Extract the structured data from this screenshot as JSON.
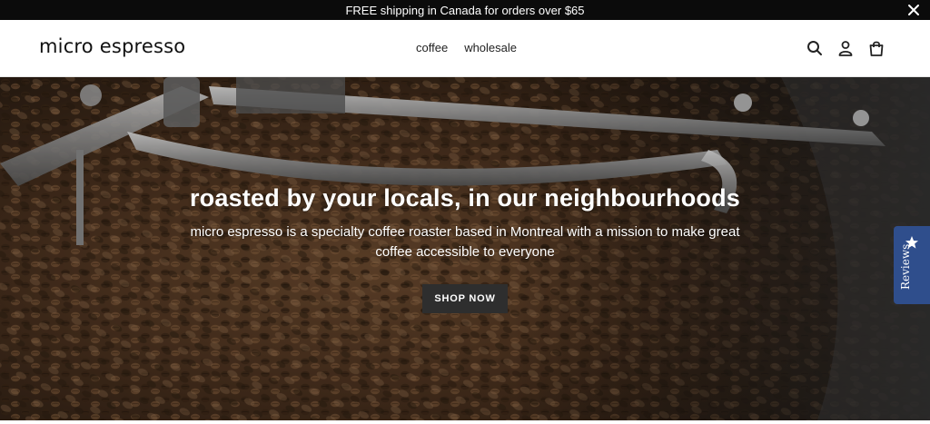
{
  "announcement": {
    "text": "FREE shipping in Canada for orders over $65",
    "close_icon": "close-icon"
  },
  "header": {
    "logo": "micro espresso",
    "nav": [
      {
        "label": "coffee"
      },
      {
        "label": "wholesale"
      }
    ],
    "icons": [
      "search-icon",
      "account-icon",
      "cart-icon"
    ]
  },
  "hero": {
    "title": "roasted by your locals, in our neighbourhoods",
    "subtitle": "micro espresso is a specialty coffee roaster based in Montreal with a mission to make great coffee accessible to everyone",
    "button_label": "SHOP NOW",
    "image": "coffee-roaster-beans-image"
  },
  "reviews_tab": {
    "label": "Reviews",
    "icon": "star-icon",
    "color": "#2f4e8c"
  },
  "colors": {
    "announcement_bg": "#0b0b0b",
    "button_bg": "#2e2e2e",
    "text": "#1a1a1a"
  }
}
